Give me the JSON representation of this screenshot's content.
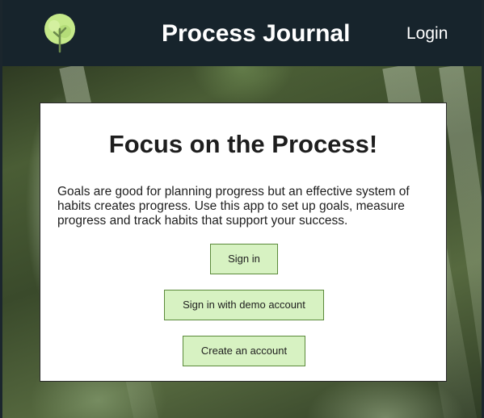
{
  "navbar": {
    "logo_icon": "tree-icon",
    "title": "Process Journal",
    "login_label": "Login",
    "background_color": "#17242c",
    "logo_color": "#c5e98a"
  },
  "hero": {
    "heading": "Focus on the Process!",
    "description": "Goals are good for planning progress but an effective system of habits creates progress. Use this app to set up goals, measure progress and track habits that support your success.",
    "buttons": {
      "sign_in": "Sign in",
      "demo_sign_in": "Sign in with demo account",
      "create_account": "Create an account"
    },
    "button_color": "#d7f2c2",
    "button_border_color": "#5b8a3a"
  }
}
